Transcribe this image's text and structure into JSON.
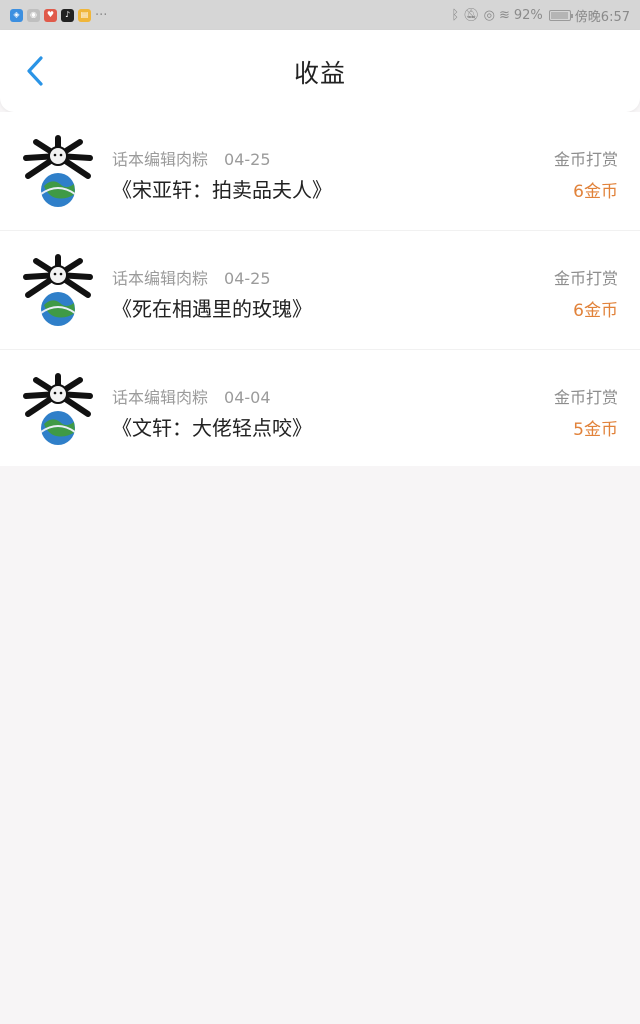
{
  "status_bar": {
    "overflow": "···",
    "battery_text": "92%",
    "time": "傍晚6:57",
    "icons": [
      "bluetooth-icon",
      "mute-icon",
      "eye-care-icon",
      "wifi-icon",
      "battery-icon"
    ],
    "app_icons": [
      "security-app-icon",
      "wechat-icon",
      "weibo-icon",
      "tiktok-icon",
      "files-icon"
    ]
  },
  "header": {
    "title": "收益",
    "back_icon": "chevron-left-icon",
    "accent_color": "#2a94e6"
  },
  "earnings": [
    {
      "author": "话本编辑肉粽",
      "date": "04-25",
      "title": "《宋亚轩：拍卖品夫人》",
      "kind": "金币打赏",
      "amount": "6金币"
    },
    {
      "author": "话本编辑肉粽",
      "date": "04-25",
      "title": "《死在相遇里的玫瑰》",
      "kind": "金币打赏",
      "amount": "6金币"
    },
    {
      "author": "话本编辑肉粽",
      "date": "04-04",
      "title": "《文轩：大佬轻点咬》",
      "kind": "金币打赏",
      "amount": "5金币"
    }
  ],
  "colors": {
    "amount": "#e1823a",
    "background": "#f7f5f6"
  }
}
